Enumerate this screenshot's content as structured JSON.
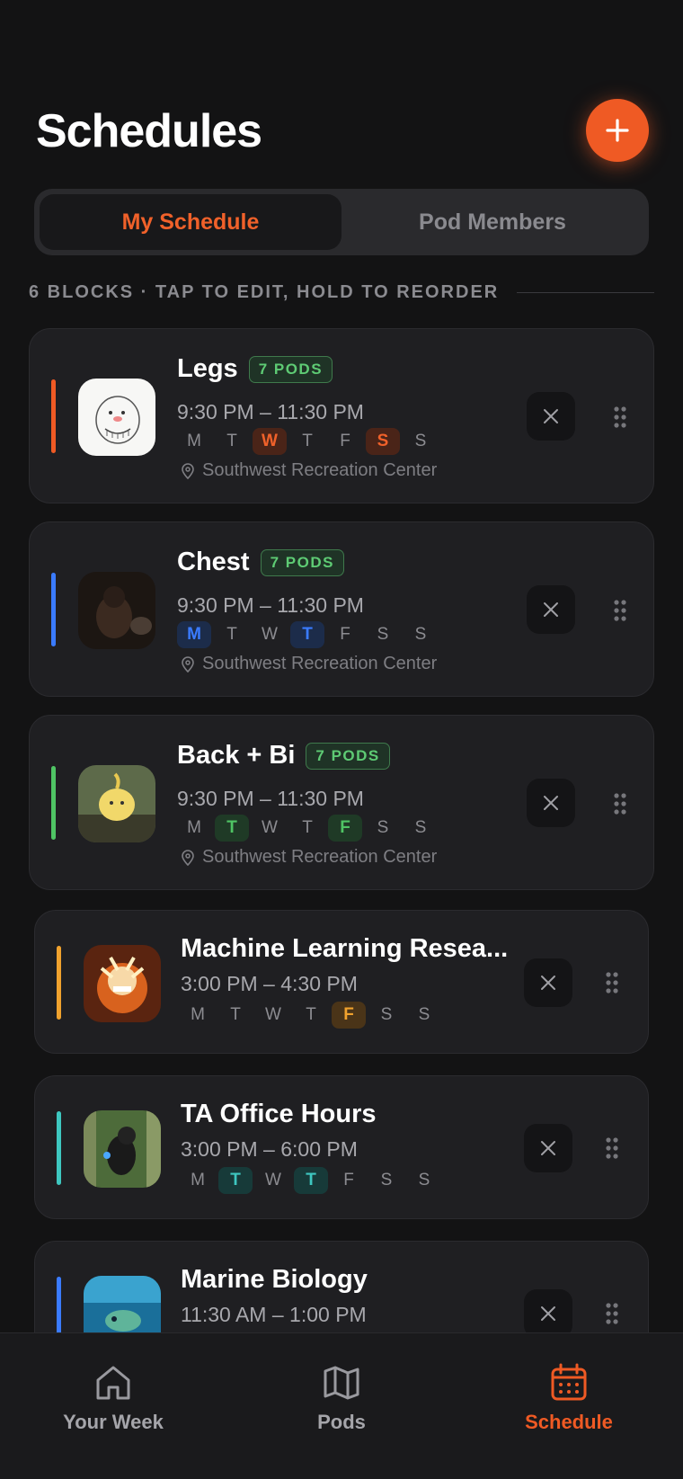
{
  "header": {
    "title": "Schedules",
    "add_icon": "plus-icon"
  },
  "segment": {
    "options": [
      "My Schedule",
      "Pod Members"
    ],
    "selected": "My Schedule"
  },
  "section": {
    "label": "6 BLOCKS · TAP TO EDIT, HOLD TO REORDER"
  },
  "colors": {
    "accent_orange": "#ef5a24",
    "blue": "#3a7bff",
    "green": "#4fc464",
    "amber": "#f0a22e",
    "teal": "#3ec7c0"
  },
  "day_letters": [
    "M",
    "T",
    "W",
    "T",
    "F",
    "S",
    "S"
  ],
  "blocks": [
    {
      "name": "Legs",
      "badge": "7 PODS",
      "time": "9:30 PM – 11:30 PM",
      "active_days": [
        2,
        5
      ],
      "color": "orange",
      "location": "Southwest Recreation Center",
      "thumb": "sketch-face-image"
    },
    {
      "name": "Chest",
      "badge": "7 PODS",
      "time": "9:30 PM – 11:30 PM",
      "active_days": [
        0,
        3
      ],
      "color": "blue",
      "location": "Southwest Recreation Center",
      "thumb": "dark-photo-image"
    },
    {
      "name": "Back + Bi",
      "badge": "7 PODS",
      "time": "9:30 PM – 11:30 PM",
      "active_days": [
        1,
        4
      ],
      "color": "green",
      "location": "Southwest Recreation Center",
      "thumb": "yellow-character-image"
    },
    {
      "name": "Machine Learning Resea...",
      "time": "3:00 PM – 4:30 PM",
      "active_days": [
        4
      ],
      "color": "amber",
      "thumb": "anime-fire-image"
    },
    {
      "name": "TA Office Hours",
      "time": "3:00 PM – 6:00 PM",
      "active_days": [
        1,
        3
      ],
      "color": "teal",
      "thumb": "dog-forest-image"
    },
    {
      "name": "Marine Biology",
      "time": "11:30 AM – 1:00 PM",
      "active_days": [],
      "color": "blue",
      "thumb": "underwater-image"
    }
  ],
  "tabs": [
    {
      "label": "Your Week",
      "icon": "home-icon",
      "active": false
    },
    {
      "label": "Pods",
      "icon": "map-icon",
      "active": false
    },
    {
      "label": "Schedule",
      "icon": "calendar-icon",
      "active": true
    }
  ]
}
